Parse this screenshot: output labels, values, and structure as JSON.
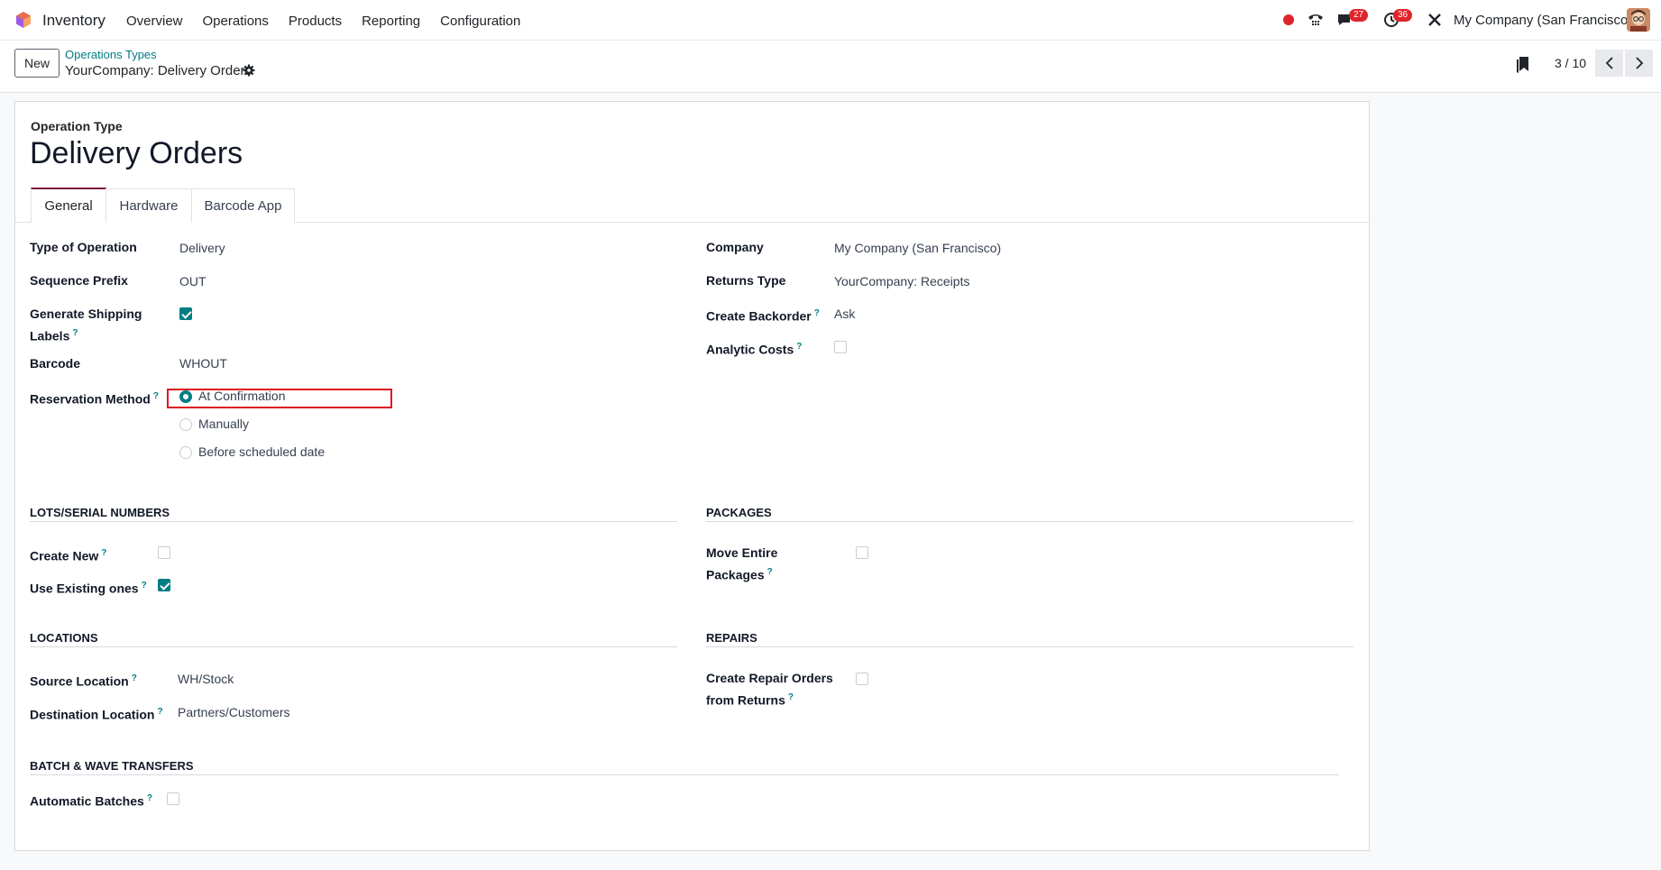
{
  "navbar": {
    "app_name": "Inventory",
    "menu": [
      "Overview",
      "Operations",
      "Products",
      "Reporting",
      "Configuration"
    ],
    "messages_badge": "27",
    "activities_badge": "36",
    "company": "My Company (San Francisco)"
  },
  "control_panel": {
    "new_label": "New",
    "breadcrumb_parent": "Operations Types",
    "breadcrumb_current": "YourCompany: Delivery Orders",
    "pager": "3 / 10"
  },
  "form": {
    "op_type_label": "Operation Type",
    "title": "Delivery Orders",
    "tabs": [
      "General",
      "Hardware",
      "Barcode App"
    ],
    "left": {
      "type_of_operation": {
        "label": "Type of Operation",
        "value": "Delivery"
      },
      "sequence_prefix": {
        "label": "Sequence Prefix",
        "value": "OUT"
      },
      "generate_shipping_labels": {
        "label_line1": "Generate Shipping",
        "label_line2": "Labels",
        "checked": true
      },
      "barcode": {
        "label": "Barcode",
        "value": "WHOUT"
      },
      "reservation_method": {
        "label": "Reservation Method",
        "options": [
          "At Confirmation",
          "Manually",
          "Before scheduled date"
        ],
        "selected": "At Confirmation"
      }
    },
    "right": {
      "company": {
        "label": "Company",
        "value": "My Company (San Francisco)"
      },
      "returns_type": {
        "label": "Returns Type",
        "value": "YourCompany: Receipts"
      },
      "create_backorder": {
        "label": "Create Backorder",
        "value": "Ask"
      },
      "analytic_costs": {
        "label": "Analytic Costs",
        "checked": false
      }
    },
    "lots": {
      "section": "LOTS/SERIAL NUMBERS",
      "create_new": {
        "label": "Create New",
        "checked": false
      },
      "use_existing": {
        "label": "Use Existing ones",
        "checked": true
      }
    },
    "packages": {
      "section": "PACKAGES",
      "move_entire": {
        "label_line1": "Move Entire",
        "label_line2": "Packages",
        "checked": false
      }
    },
    "locations": {
      "section": "LOCATIONS",
      "source": {
        "label": "Source Location",
        "value": "WH/Stock"
      },
      "destination": {
        "label": "Destination Location",
        "value": "Partners/Customers"
      }
    },
    "repairs": {
      "section": "REPAIRS",
      "create_repair": {
        "label_line1": "Create Repair Orders",
        "label_line2": "from Returns",
        "checked": false
      }
    },
    "batch": {
      "section": "BATCH & WAVE TRANSFERS",
      "automatic_batches": {
        "label": "Automatic Batches",
        "checked": false
      }
    },
    "help_mark": "?"
  },
  "colors": {
    "accent": "#017e84",
    "highlight": "#e0141e",
    "tab_active": "#7e1d3a"
  }
}
